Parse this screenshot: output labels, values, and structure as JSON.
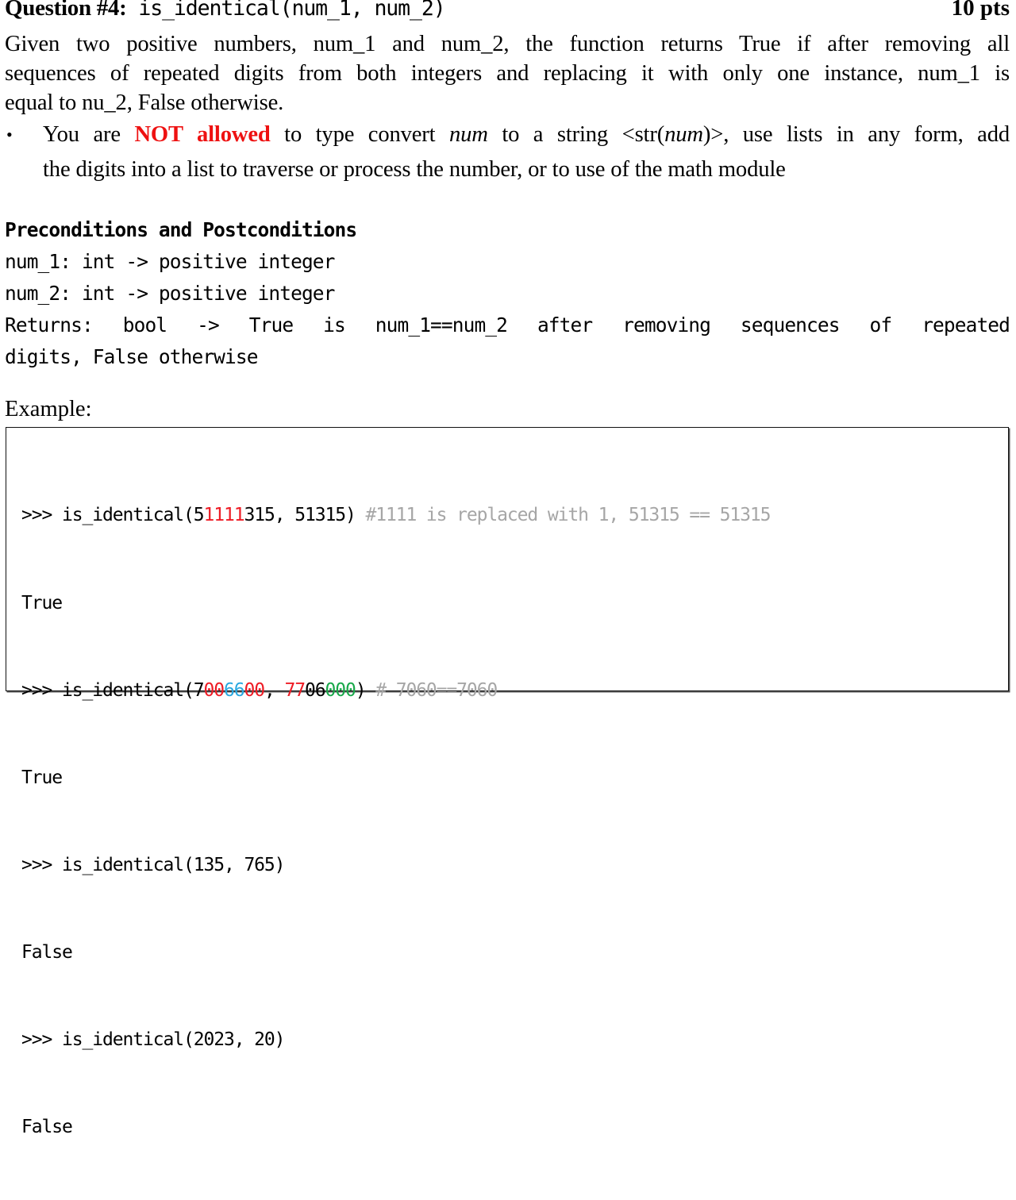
{
  "question": {
    "label": "Question #4:",
    "signature": " is_identical(num_1, num_2)",
    "points": "10 pts"
  },
  "description": {
    "lines": [
      "Given two positive numbers, num_1 and num_2, the function returns True if after removing all",
      "sequences of repeated digits from both integers and replacing it with only one instance, num_1 is",
      "equal to nu_2, False otherwise."
    ]
  },
  "rules": {
    "bullet": "•",
    "line1_pre": "You are ",
    "line1_emph": "NOT allowed",
    "line1_mid": " to type convert ",
    "line1_italic": "num",
    "line1_mid2": " to a string <str(",
    "line1_italic2": "num",
    "line1_post": ")>, use lists in any form, add",
    "line2": "the digits into a list to traverse or process the number, or to use of the math module",
    "emph_color": "#ee1111"
  },
  "conditions": {
    "heading": "Preconditions and Postconditions",
    "lines": [
      "num_1: int -> positive integer",
      "num_2: int -> positive integer",
      "Returns: bool -> True is num_1==num_2 after removing sequences of repeated",
      "digits, False otherwise"
    ]
  },
  "example": {
    "label": "Example:",
    "ex1": {
      "prompt": ">>> is_identical(",
      "a_pre": "5",
      "a_red": "1111",
      "a_post": "315",
      "sep": ", ",
      "b": "51315",
      "close": ")",
      "comment": " #1111 is replaced with 1, 51315 == 51315",
      "result": "True"
    },
    "ex2": {
      "prompt": ">>> is_identical(",
      "a_pre": "7",
      "a_red1": "00",
      "a_blue": "66",
      "a_red2": "00",
      "sep": ", ",
      "b_red": "77",
      "b_mid": "06",
      "b_green": "000",
      "close": ")",
      "comment": " # 7060==7060",
      "result": "True"
    },
    "ex3": {
      "call": ">>> is_identical(135, 765)",
      "result": "False"
    },
    "ex4": {
      "call": ">>> is_identical(2023, 20)",
      "result": "False"
    },
    "colors": {
      "red": "#ee1c25",
      "blue": "#29a8e0",
      "green": "#19a84a",
      "comment": "#a6a6a6"
    }
  }
}
